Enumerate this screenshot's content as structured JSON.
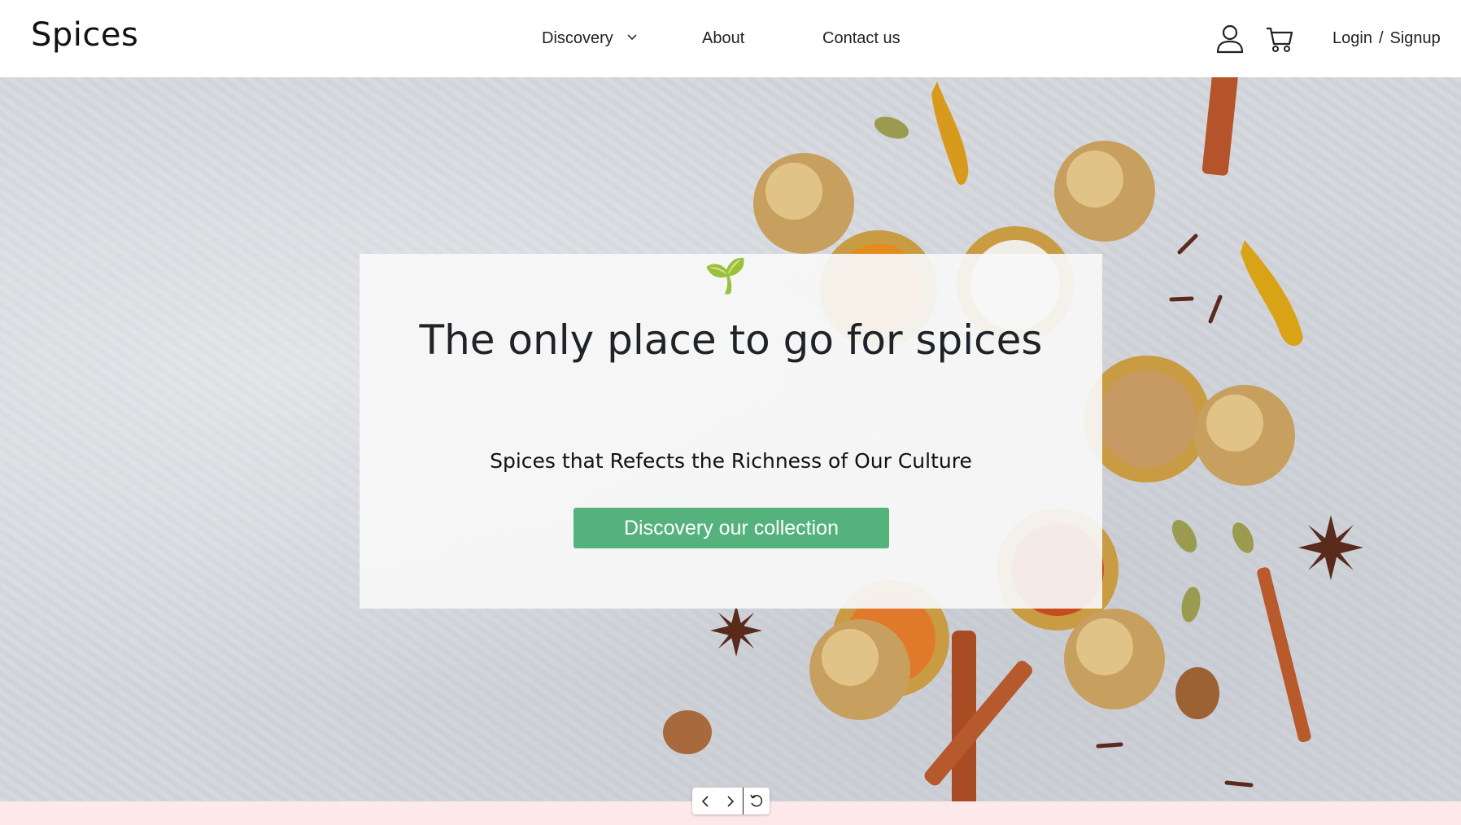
{
  "header": {
    "logo": "Spices",
    "nav": [
      {
        "label": "Discovery",
        "has_dropdown": true
      },
      {
        "label": "About"
      },
      {
        "label": "Contact us"
      }
    ],
    "icons": [
      "user-icon",
      "cart-icon"
    ],
    "login_label": "Login",
    "separator": "/",
    "signup_label": "Signup"
  },
  "hero": {
    "emoji": "🌱",
    "headline": "The only place to go for spices",
    "subheadline": "Spices that Refects the Richness of Our Culture",
    "cta_label": "Discovery our collection",
    "cta_color": "#55b27d"
  },
  "carousel": {
    "icons": [
      "chevron-left-icon",
      "chevron-right-icon",
      "refresh-icon"
    ]
  },
  "colors": {
    "background_band": "#fde9ea"
  }
}
